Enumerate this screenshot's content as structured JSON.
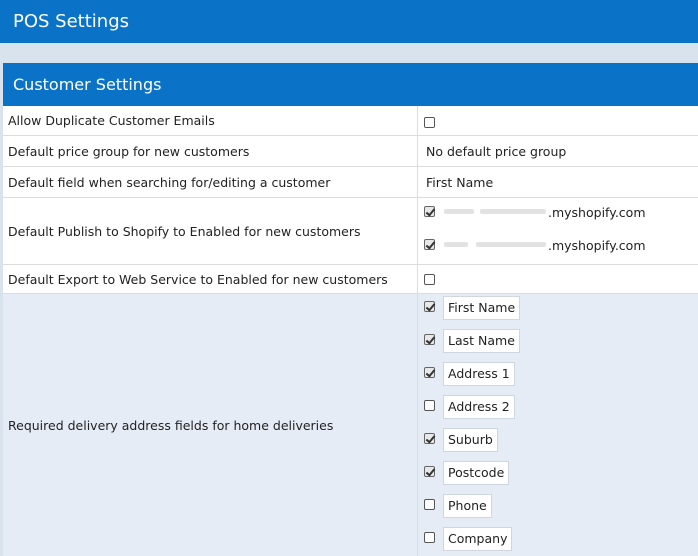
{
  "app": {
    "title": "POS Settings"
  },
  "panel": {
    "title": "Customer Settings"
  },
  "rows": {
    "allow_duplicate": {
      "label": "Allow Duplicate Customer Emails",
      "checked": false
    },
    "default_price_group": {
      "label": "Default price group for new customers",
      "value": "No default price group"
    },
    "default_search_field": {
      "label": "Default field when searching for/editing a customer",
      "value": "First Name"
    },
    "default_publish": {
      "label": "Default Publish to Shopify to Enabled for new customers",
      "stores": [
        {
          "suffix": ".myshopify.com",
          "checked": true
        },
        {
          "suffix": ".myshopify.com",
          "checked": true
        }
      ]
    },
    "default_export": {
      "label": "Default Export to Web Service to Enabled for new customers",
      "checked": false
    },
    "required_delivery": {
      "label": "Required delivery address fields for home deliveries",
      "fields": [
        {
          "label": "First Name",
          "checked": true
        },
        {
          "label": "Last Name",
          "checked": true
        },
        {
          "label": "Address 1",
          "checked": true
        },
        {
          "label": "Address 2",
          "checked": false
        },
        {
          "label": "Suburb",
          "checked": true
        },
        {
          "label": "Postcode",
          "checked": true
        },
        {
          "label": "Phone",
          "checked": false
        },
        {
          "label": "Company",
          "checked": false
        }
      ]
    }
  },
  "colors": {
    "header_blue": "#0a73c7",
    "gap_grey": "#d9e3ee",
    "field_area_bg": "#e6ecf6"
  }
}
